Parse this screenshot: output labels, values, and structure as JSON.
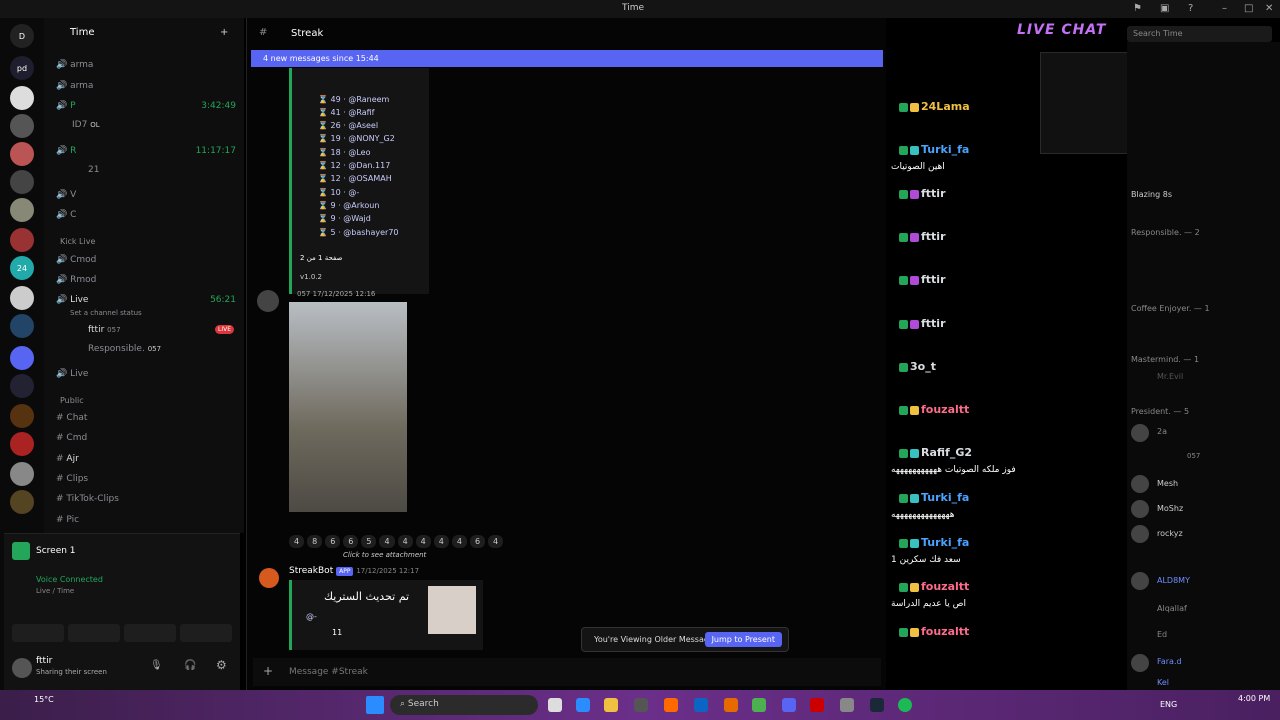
{
  "titlebar": {
    "title": "Time"
  },
  "server_header": {
    "name": "Time"
  },
  "channels": {
    "top": [
      {
        "icon": "speaker-icon",
        "label": "arma"
      },
      {
        "icon": "speaker-icon",
        "label": "arma"
      },
      {
        "icon": "speaker-icon",
        "label": "P",
        "time": "3:42:49"
      },
      {
        "icon": "speaker-icon",
        "label": "R",
        "time": "11:17:17"
      },
      {
        "icon": "speaker-icon",
        "label": "V"
      },
      {
        "icon": "speaker-icon",
        "label": "C"
      }
    ],
    "voice_users": [
      {
        "name": "ID7",
        "tag": "OL"
      },
      {
        "name": "21"
      }
    ],
    "cat_kick": "Kick Live",
    "kick": [
      {
        "label": "Cmod"
      },
      {
        "label": "Rmod"
      },
      {
        "label": "Live",
        "time": "56:21",
        "status": "Set a channel status"
      },
      {
        "label": "Live"
      }
    ],
    "live_users": [
      {
        "name": "fttir",
        "tag": "057",
        "badge": "LIVE"
      },
      {
        "name": "Responsible.",
        "tag": "057"
      }
    ],
    "cat_public": "Public",
    "public": [
      {
        "label": "Chat"
      },
      {
        "label": "Cmd"
      },
      {
        "label": "Ajr"
      },
      {
        "label": "Clips"
      },
      {
        "label": "TikTok-Clips"
      },
      {
        "label": "Pic"
      }
    ]
  },
  "panel": {
    "screen": "Screen 1",
    "voice_status": "Voice Connected",
    "voice_channel": "Live / Time",
    "user": "fttir",
    "user_status": "Sharing their screen"
  },
  "main": {
    "channel": "Streak",
    "new_messages": "4 new messages since 15:44",
    "leaderboard": [
      {
        "n": "49",
        "name": "@Raneem"
      },
      {
        "n": "41",
        "name": "@Rafif"
      },
      {
        "n": "26",
        "name": "@Aseel"
      },
      {
        "n": "19",
        "name": "@NONY_G2"
      },
      {
        "n": "18",
        "name": "@Leo"
      },
      {
        "n": "12",
        "name": "@Dan.117"
      },
      {
        "n": "12",
        "name": "@OSAMAH"
      },
      {
        "n": "10",
        "name": "@-"
      },
      {
        "n": "9",
        "name": "@Arkoun"
      },
      {
        "n": "9",
        "name": "@Wajd"
      },
      {
        "n": "5",
        "name": "@bashayer70"
      }
    ],
    "page": "صفحة 1 من 2",
    "version": "v1.0.2",
    "msg_tag": "057",
    "msg_date": "17/12/2025 12:16",
    "reactions": [
      "4",
      "8",
      "6",
      "6",
      "5",
      "4",
      "4",
      "4",
      "4",
      "4",
      "6",
      "4"
    ],
    "reply": "Click to see attachment",
    "bot_name": "StreakBot",
    "bot_tag": "APP",
    "bot_date": "17/12/2025 12:17",
    "bot_text": "تم تحديث الستريك",
    "bot_mention": "@-",
    "bot_count": "11",
    "older_text": "You're Viewing Older Messages",
    "jump": "Jump to Present",
    "input_placeholder": "Message #Streak"
  },
  "livechat": {
    "logo": "LIVE CHAT",
    "messages": [
      {
        "user": "24Lama",
        "color": "#f0c040",
        "text": ""
      },
      {
        "user": "Turki_fa",
        "color": "#4aa3ff",
        "text": "اهين الصوتيات"
      },
      {
        "user": "fttir",
        "color": "#ffffff",
        "text": ""
      },
      {
        "user": "fttir",
        "color": "#ffffff",
        "text": ""
      },
      {
        "user": "fttir",
        "color": "#ffffff",
        "text": ""
      },
      {
        "user": "fttir",
        "color": "#ffffff",
        "text": ""
      },
      {
        "user": "3o_t",
        "color": "#ffffff",
        "text": ""
      },
      {
        "user": "fouzaltt",
        "color": "#ff6b8b",
        "text": ""
      },
      {
        "user": "Rafif_G2",
        "color": "#ffffff",
        "text": "فوز ملكه الصوتيات هههههههههههه"
      },
      {
        "user": "Turki_fa",
        "color": "#4aa3ff",
        "text": "ههههههههههههههه"
      },
      {
        "user": "Turki_fa",
        "color": "#4aa3ff",
        "text": "سعد فك سكرين 1"
      },
      {
        "user": "fouzaltt",
        "color": "#ff6b8b",
        "text": "اص يا عديم الدراسة"
      },
      {
        "user": "fouzaltt",
        "color": "#ff6b8b",
        "text": ""
      }
    ]
  },
  "search": {
    "placeholder": "Search Time"
  },
  "members": {
    "blazing": "Blazing 8s",
    "responsible_cat": "Responsible. — 2",
    "coffee_cat": "Coffee Enjoyer. — 1",
    "mastermind_cat": "Mastermind. — 1",
    "president_cat": "President. — 5",
    "users": [
      "Mr.Evil",
      "2a",
      "057",
      "Mesh",
      "MoShz",
      "rockyz",
      "ALD8MY",
      "Alqallaf",
      "Ed",
      "Fara.d",
      "Kel"
    ]
  },
  "taskbar": {
    "weather": "15°C",
    "search": "Search",
    "lang": "ENG",
    "time": "4:00 PM"
  }
}
